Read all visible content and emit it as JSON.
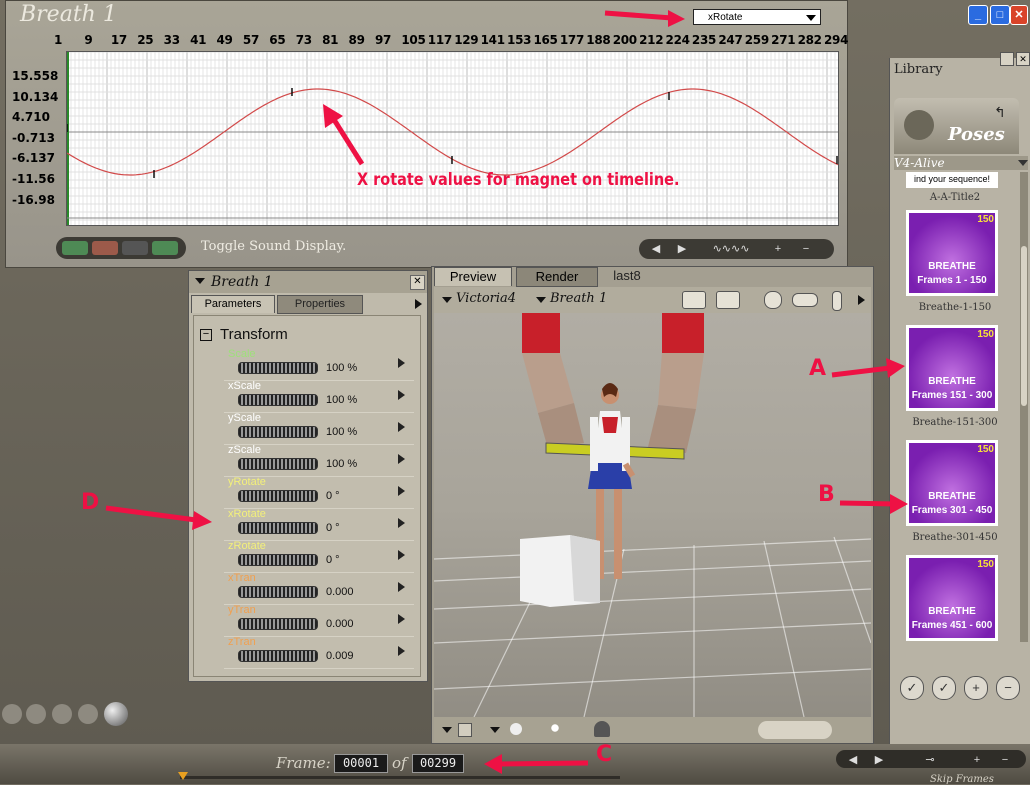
{
  "graph": {
    "title": "Breath 1",
    "parameter_select": "xRotate",
    "frame_ticks": [
      "1",
      "9",
      "17",
      "25",
      "33",
      "41",
      "49",
      "57",
      "65",
      "73",
      "81",
      "89",
      "97",
      "105",
      "117",
      "129",
      "141",
      "153",
      "165",
      "177",
      "188",
      "200",
      "212",
      "224",
      "235",
      "247",
      "259",
      "271",
      "282",
      "294"
    ],
    "value_ticks": [
      "15.558",
      "10.134",
      "4.710",
      "-0.713",
      "-6.137",
      "-11.56",
      "-16.98"
    ],
    "annotation": "X rotate values for magnet on timeline.",
    "toggle_sound_label": "Toggle Sound Display.",
    "curve_color": "#d24a4a"
  },
  "params": {
    "title": "Breath 1",
    "tab_parameters": "Parameters",
    "tab_properties": "Properties",
    "group": "Transform",
    "group_toggle": "−",
    "rows": [
      {
        "label": "Scale",
        "value": "100 %",
        "color": "#9ee07a"
      },
      {
        "label": "xScale",
        "value": "100 %",
        "color": "#ffffff"
      },
      {
        "label": "yScale",
        "value": "100 %",
        "color": "#ffffff"
      },
      {
        "label": "zScale",
        "value": "100 %",
        "color": "#ffffff"
      },
      {
        "label": "yRotate",
        "value": "0 °",
        "color": "#f3f07a"
      },
      {
        "label": "xRotate",
        "value": "0 °",
        "color": "#f3f07a"
      },
      {
        "label": "zRotate",
        "value": "0 °",
        "color": "#f3f07a"
      },
      {
        "label": "xTran",
        "value": "0.000",
        "color": "#f0a050"
      },
      {
        "label": "yTran",
        "value": "0.000",
        "color": "#f0a050"
      },
      {
        "label": "zTran",
        "value": "0.009",
        "color": "#f0a050"
      }
    ]
  },
  "viewport": {
    "tab_preview": "Preview",
    "tab_render": "Render",
    "tab_last": "last8",
    "figure_select": "Victoria4",
    "actor_select": "Breath 1"
  },
  "library": {
    "title": "Library",
    "poses_label": "Poses",
    "category": "V4-Alive",
    "top_partial_caption": "A-A-Title2",
    "top_partial_text": "ind your sequence!",
    "items": [
      {
        "t1": "BREATHE",
        "t2": "Frames 1 - 150",
        "badge": "150",
        "caption": "Breathe-1-150"
      },
      {
        "t1": "BREATHE",
        "t2": "Frames 151 - 300",
        "badge": "150",
        "caption": "Breathe-151-300"
      },
      {
        "t1": "BREATHE",
        "t2": "Frames 301 - 450",
        "badge": "150",
        "caption": "Breathe-301-450"
      },
      {
        "t1": "BREATHE",
        "t2": "Frames 451 - 600",
        "badge": "150",
        "caption": ""
      }
    ]
  },
  "timeline": {
    "frame_label": "Frame:",
    "current_frame": "00001",
    "of_label": "of",
    "total_frames": "00299",
    "skip_frames": "Skip Frames"
  },
  "annotations": {
    "a": "A",
    "b": "B",
    "c": "C",
    "d": "D",
    "color": "#ee1144"
  }
}
